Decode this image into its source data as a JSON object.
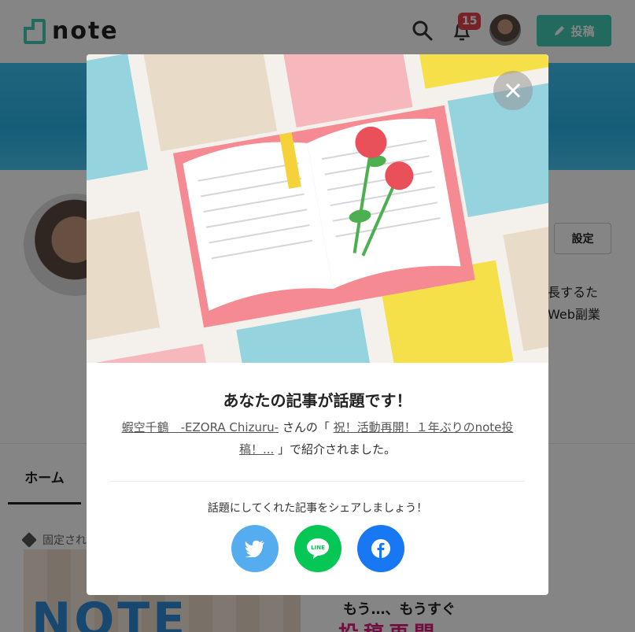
{
  "header": {
    "logo_text": "note",
    "notification_count": "15",
    "post_button_label": "投稿"
  },
  "profile": {
    "settings_label": "設定",
    "bio_line1": "長するた",
    "bio_line2": "Web副業"
  },
  "tabs": {
    "home_label": "ホーム"
  },
  "pinned": {
    "label": "固定され"
  },
  "thumbs": {
    "thumb1_text": "NOTE",
    "thumb2_text_top": "もう…、もうすぐ",
    "thumb2_text_bottom": "投稿再開"
  },
  "modal": {
    "title": "あなたの記事が話題です！",
    "author_link": "蝦空千鶴　-EZORA Chizuru-",
    "text_san": " さんの「 ",
    "article_link": "祝！活動再開！１年ぶりのnote投稿！...",
    "text_end": " 」で紹介されました。",
    "share_prompt": "話題にしてくれた記事をシェアしましょう！",
    "line_label": "LINE"
  },
  "colors": {
    "brand": "#41c9b4",
    "twitter": "#55acee",
    "line": "#06c755",
    "facebook": "#1877f2",
    "badge": "#e0434f"
  }
}
